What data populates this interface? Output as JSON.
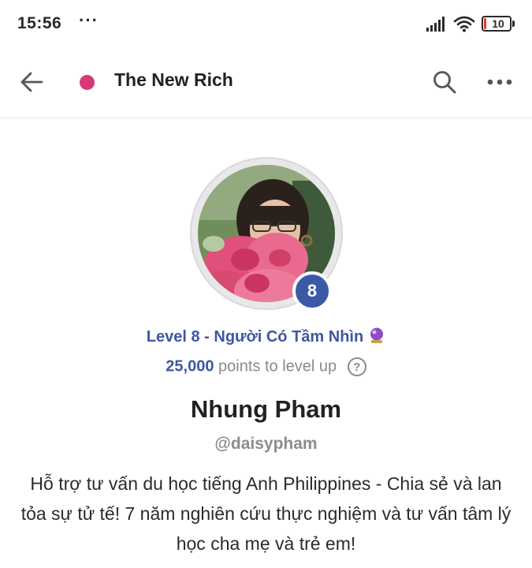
{
  "status_bar": {
    "time": "15:56",
    "dots": "···",
    "battery": "10",
    "icons": [
      "signal-icon",
      "wifi-icon",
      "battery-icon"
    ]
  },
  "app_bar": {
    "title": "The New Rich",
    "community_color": "#d63a76",
    "icons": [
      "back-arrow-icon",
      "search-icon",
      "more-icon"
    ]
  },
  "profile": {
    "level_badge": "8",
    "level_title": "Level 8 - Người Có Tầm Nhìn",
    "level_icon": "crystal-ball-icon",
    "points": "25,000",
    "points_suffix": "points to level up",
    "help_icon": "?",
    "name": "Nhung Pham",
    "username": "@daisypham",
    "bio": "Hỗ trợ tư vấn du học tiếng Anh Philippines - Chia sẻ và lan tỏa sự tử tế! 7 năm nghiên cứu thực nghiệm và tư vấn tâm lý học cha mẹ và trẻ em!"
  },
  "colors": {
    "accent": "#3e57a3",
    "badge": "#3c59a8",
    "muted": "#8a8a8a"
  }
}
